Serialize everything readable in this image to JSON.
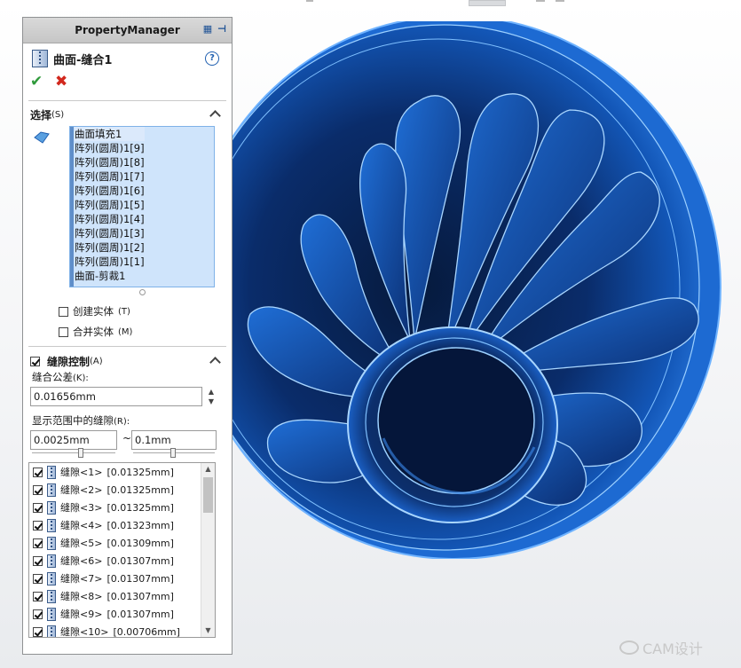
{
  "colors": {
    "accent": "#1f5fb0",
    "selection_bg": "#cfe4fb",
    "model_blue": "#1a5fc4",
    "ok_green": "#2f9a3b",
    "cancel_red": "#d2281d"
  },
  "panel": {
    "title": "PropertyManager",
    "feature_title": "曲面-缝合1",
    "help_icon": "?",
    "ok_icon": "✔",
    "cancel_icon": "✖"
  },
  "selection": {
    "heading": "选择",
    "heading_key": "(S)",
    "items": [
      "曲面填充1",
      "阵列(圆周)1[9]",
      "阵列(圆周)1[8]",
      "阵列(圆周)1[7]",
      "阵列(圆周)1[6]",
      "阵列(圆周)1[5]",
      "阵列(圆周)1[4]",
      "阵列(圆周)1[3]",
      "阵列(圆周)1[2]",
      "阵列(圆周)1[1]",
      "曲面-剪裁1"
    ],
    "create_solid": {
      "label": "创建实体",
      "key": "(T)",
      "checked": false
    },
    "merge_solid": {
      "label": "合并实体",
      "key": "(M)",
      "checked": false
    }
  },
  "gap_control": {
    "heading": "缝隙控制",
    "heading_key": "(A)",
    "checked": true,
    "tolerance_label": "缝合公差",
    "tolerance_key": "(K):",
    "tolerance_value": "0.01656mm",
    "range_label": "显示范围中的缝隙",
    "range_key": "(R):",
    "range_min": "0.0025mm",
    "range_sep": "~",
    "range_max": "0.1mm",
    "gaps": [
      {
        "label": "缝隙<1>",
        "value": "[0.01325mm]",
        "checked": true
      },
      {
        "label": "缝隙<2>",
        "value": "[0.01325mm]",
        "checked": true
      },
      {
        "label": "缝隙<3>",
        "value": "[0.01325mm]",
        "checked": true
      },
      {
        "label": "缝隙<4>",
        "value": "[0.01323mm]",
        "checked": true
      },
      {
        "label": "缝隙<5>",
        "value": "[0.01309mm]",
        "checked": true
      },
      {
        "label": "缝隙<6>",
        "value": "[0.01307mm]",
        "checked": true
      },
      {
        "label": "缝隙<7>",
        "value": "[0.01307mm]",
        "checked": true
      },
      {
        "label": "缝隙<8>",
        "value": "[0.01307mm]",
        "checked": true
      },
      {
        "label": "缝隙<9>",
        "value": "[0.01307mm]",
        "checked": true
      },
      {
        "label": "缝隙<10>",
        "value": "[0.00706mm]",
        "checked": true
      }
    ]
  },
  "watermark": "CAM设计"
}
